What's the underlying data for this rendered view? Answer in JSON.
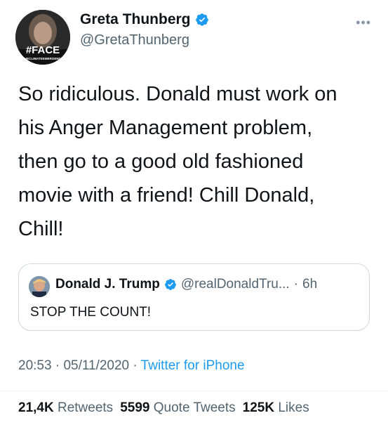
{
  "author": {
    "display_name": "Greta Thunberg",
    "handle": "@GretaThunberg",
    "verified": true,
    "avatar_badge": "#FACE",
    "avatar_subtext": "THECLIMATEEMERGENCY"
  },
  "more_icon": "more-horizontal-icon",
  "tweet": {
    "text": "So ridiculous. Donald must work on\nhis Anger Management problem,\nthen go to a good old fashioned\nmovie with a friend! Chill Donald,\nChill!"
  },
  "quoted_tweet": {
    "display_name": "Donald J. Trump",
    "handle": "@realDonaldTru...",
    "separator": "·",
    "time": "6h",
    "text": "STOP THE COUNT!",
    "verified": true
  },
  "meta": {
    "time": "20:53",
    "separator1": "·",
    "date": "05/11/2020",
    "separator2": "·",
    "source": "Twitter for iPhone"
  },
  "stats": {
    "retweets_count": "21,4K",
    "retweets_label": "Retweets",
    "quotes_count": "5599",
    "quotes_label": "Quote Tweets",
    "likes_count": "125K",
    "likes_label": "Likes"
  },
  "colors": {
    "text_primary": "#0f1419",
    "text_secondary": "#536471",
    "accent": "#1d9bf0",
    "border": "#cfd9de"
  }
}
